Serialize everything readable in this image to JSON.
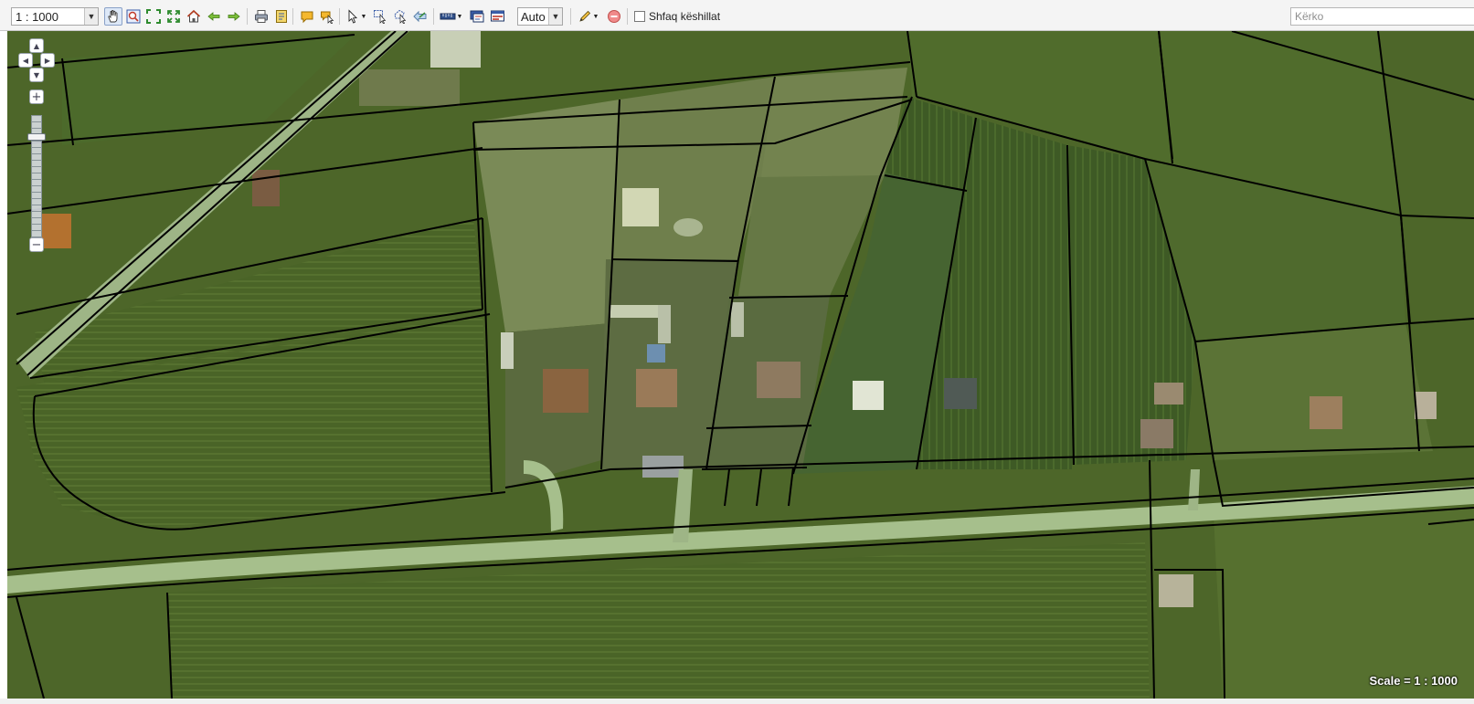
{
  "toolbar": {
    "scale_value": "1 : 1000",
    "auto_value": "Auto",
    "tips_label": "Shfaq këshillat",
    "tips_checked": false,
    "icons": [
      "pan-hand-icon",
      "zoom-window-icon",
      "zoom-extent-icon",
      "zoom-fit-icon",
      "home-icon",
      "back-arrow-icon",
      "forward-arrow-icon",
      "print-icon",
      "export-icon",
      "comment-icon",
      "identify-icon",
      "select-arrow-icon",
      "select-box-icon",
      "select-polygon-icon",
      "clear-selection-icon",
      "measure-icon",
      "layers-icon",
      "map-settings-icon",
      "draw-pencil-icon",
      "stop-icon"
    ]
  },
  "search": {
    "placeholder": "Kërko",
    "value": ""
  },
  "map": {
    "scale_text": "Scale = 1 : 1000",
    "colors": {
      "field": "#4d6629",
      "field_light": "#6f8444",
      "road": "#a9c18f",
      "parcel_line": "#000000",
      "building": "#c9cfa8"
    }
  },
  "navigation": {
    "controls": [
      "pan-up-icon",
      "pan-left-icon",
      "pan-right-icon",
      "pan-down-icon",
      "zoom-in-icon",
      "zoom-out-icon"
    ]
  }
}
